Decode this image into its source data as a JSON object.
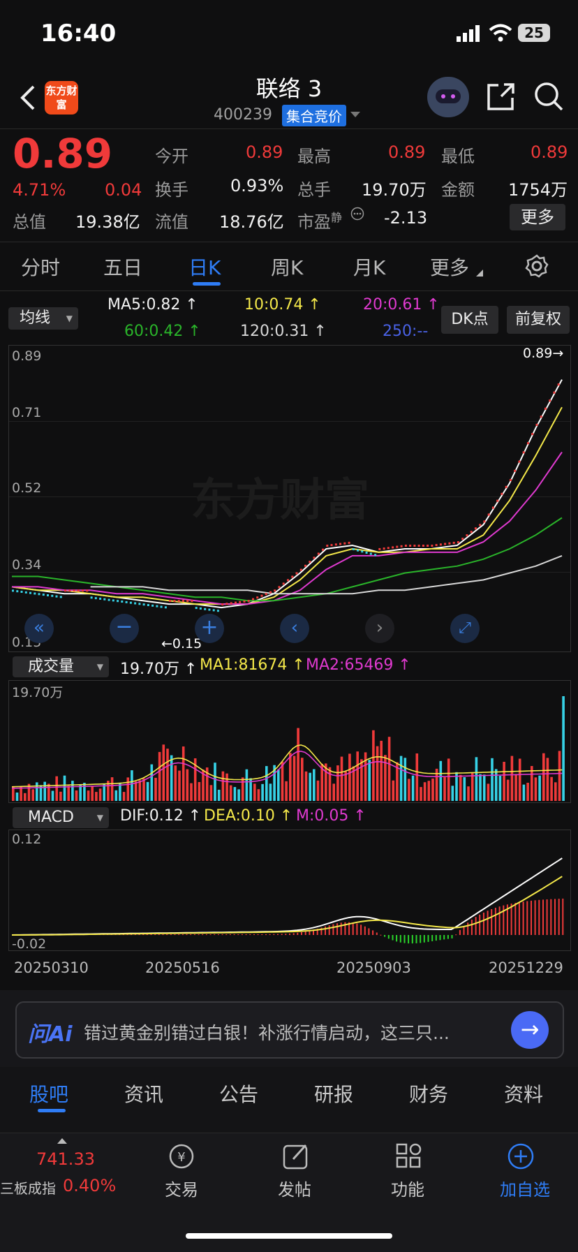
{
  "status": {
    "time": "16:40",
    "battery": "25"
  },
  "header": {
    "title": "联络 3",
    "code": "400239",
    "badge": "集合竞价",
    "logo": "东方财富"
  },
  "quote": {
    "price": "0.89",
    "pct": "4.71%",
    "change": "0.04",
    "open_label": "今开",
    "open": "0.89",
    "high_label": "最高",
    "high": "0.89",
    "low_label": "最低",
    "low": "0.89",
    "turnover_label": "换手",
    "turnover": "0.93%",
    "vol_label": "总手",
    "vol": "19.70万",
    "amount_label": "金额",
    "amount": "1754万",
    "mcap_label": "总值",
    "mcap": "19.38亿",
    "float_label": "流值",
    "float": "18.76亿",
    "pe_label": "市盈",
    "pe_sup": "静",
    "pe": "-2.13",
    "more": "更多"
  },
  "tabs": [
    "分时",
    "五日",
    "日K",
    "周K",
    "月K",
    "更多"
  ],
  "ma": {
    "selector": "均线",
    "ma5": "MA5:0.82",
    "ma10": "10:0.74",
    "ma20": "20:0.61",
    "ma60": "60:0.42",
    "ma120": "120:0.31",
    "ma250": "250:--",
    "dk": "DK点",
    "adj": "前复权"
  },
  "colors": {
    "up": "#f03a3a",
    "down": "#36d2e6",
    "accent": "#2f7df6"
  },
  "kline": {
    "y_labels": [
      "0.89",
      "0.71",
      "0.52",
      "0.34",
      "0.15"
    ],
    "last_tag": "0.89",
    "low_tag": "0.15",
    "watermark": "东方财富"
  },
  "volume": {
    "selector": "成交量",
    "vol": "19.70万",
    "ma1": "MA1:81674",
    "ma2": "MA2:65469",
    "y_top": "19.70万"
  },
  "macd": {
    "selector": "MACD",
    "dif": "DIF:0.12",
    "dea": "DEA:0.10",
    "m": "M:0.05",
    "y_top": "0.12",
    "y_bottom": "-0.02"
  },
  "chart_data": {
    "type": "line",
    "title": "",
    "x_ticks": [
      "20250310",
      "20250516",
      "20250903",
      "20251229"
    ],
    "ylim": [
      0.15,
      0.89
    ],
    "series": [
      {
        "name": "MA5",
        "values": [
          0.22,
          0.21,
          0.2,
          0.2,
          0.19,
          0.18,
          0.17,
          0.17,
          0.16,
          0.17,
          0.2,
          0.26,
          0.33,
          0.34,
          0.32,
          0.33,
          0.33,
          0.34,
          0.4,
          0.52,
          0.68,
          0.82
        ]
      },
      {
        "name": "MA10",
        "values": [
          0.22,
          0.21,
          0.21,
          0.2,
          0.19,
          0.19,
          0.18,
          0.17,
          0.17,
          0.17,
          0.19,
          0.24,
          0.31,
          0.33,
          0.32,
          0.32,
          0.33,
          0.33,
          0.37,
          0.47,
          0.6,
          0.74
        ]
      },
      {
        "name": "MA20",
        "values": [
          0.22,
          0.22,
          0.21,
          0.21,
          0.2,
          0.2,
          0.19,
          0.18,
          0.17,
          0.17,
          0.18,
          0.21,
          0.27,
          0.31,
          0.31,
          0.32,
          0.32,
          0.32,
          0.35,
          0.41,
          0.5,
          0.61
        ]
      },
      {
        "name": "MA60",
        "values": [
          0.25,
          0.25,
          0.24,
          0.23,
          0.22,
          0.21,
          0.2,
          0.19,
          0.19,
          0.18,
          0.18,
          0.19,
          0.2,
          0.22,
          0.24,
          0.26,
          0.27,
          0.28,
          0.3,
          0.33,
          0.37,
          0.42
        ]
      },
      {
        "name": "MA120",
        "values": [
          null,
          null,
          null,
          0.22,
          0.22,
          0.22,
          0.21,
          0.21,
          0.21,
          0.21,
          0.2,
          0.2,
          0.2,
          0.2,
          0.21,
          0.21,
          0.22,
          0.23,
          0.24,
          0.26,
          0.28,
          0.31
        ]
      }
    ]
  },
  "toolbar": {
    "ai_label": "问Ai",
    "ai_text": "错过黄金别错过白银！补涨行情启动，这三只..."
  },
  "subtabs": [
    "股吧",
    "资讯",
    "公告",
    "研报",
    "财务",
    "资料"
  ],
  "bottom": {
    "index_value": "741.33",
    "index_name": "三板成指",
    "index_pct": "0.40%",
    "trade": "交易",
    "post": "发帖",
    "func": "功能",
    "watch": "加自选"
  }
}
